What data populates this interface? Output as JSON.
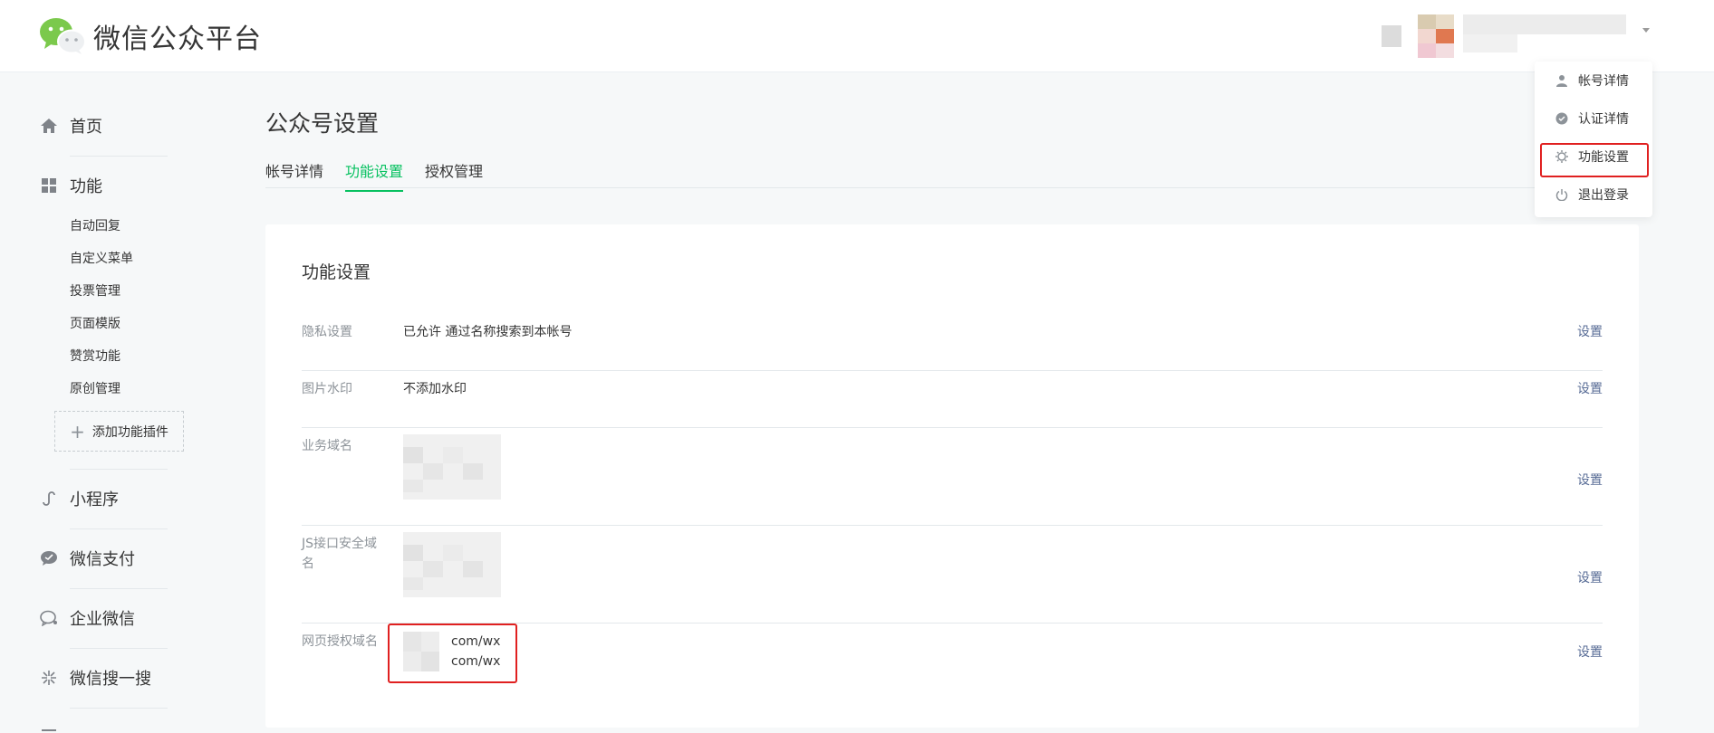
{
  "header": {
    "brand": "微信公众平台"
  },
  "sidebar": {
    "home": "首页",
    "features": "功能",
    "features_items": [
      "自动回复",
      "自定义菜单",
      "投票管理",
      "页面模版",
      "赞赏功能",
      "原创管理"
    ],
    "add_plugin": "添加功能插件",
    "mini_program": "小程序",
    "wechat_pay": "微信支付",
    "work_wechat": "企业微信",
    "wechat_search": "微信搜一搜"
  },
  "page": {
    "title": "公众号设置",
    "tabs": [
      "帐号详情",
      "功能设置",
      "授权管理"
    ],
    "active_tab": "功能设置"
  },
  "card": {
    "title": "功能设置",
    "rows": [
      {
        "label": "隐私设置",
        "value": "已允许 通过名称搜索到本帐号",
        "action": "设置"
      },
      {
        "label": "图片水印",
        "value": "不添加水印",
        "action": "设置"
      },
      {
        "label": "业务域名",
        "value": "",
        "action": "设置"
      },
      {
        "label": "JS接口安全域名",
        "value": "",
        "action": "设置"
      },
      {
        "label": "网页授权域名",
        "value_lines": [
          "com/wx",
          "com/wx"
        ],
        "action": "设置"
      }
    ]
  },
  "dropdown": {
    "items": [
      {
        "label": "帐号详情",
        "icon": "user-icon"
      },
      {
        "label": "认证详情",
        "icon": "verified-icon"
      },
      {
        "label": "功能设置",
        "icon": "gear-icon"
      },
      {
        "label": "退出登录",
        "icon": "power-icon"
      }
    ]
  },
  "colors": {
    "accent": "#07c160",
    "link": "#576b95",
    "highlight": "#e02020"
  }
}
